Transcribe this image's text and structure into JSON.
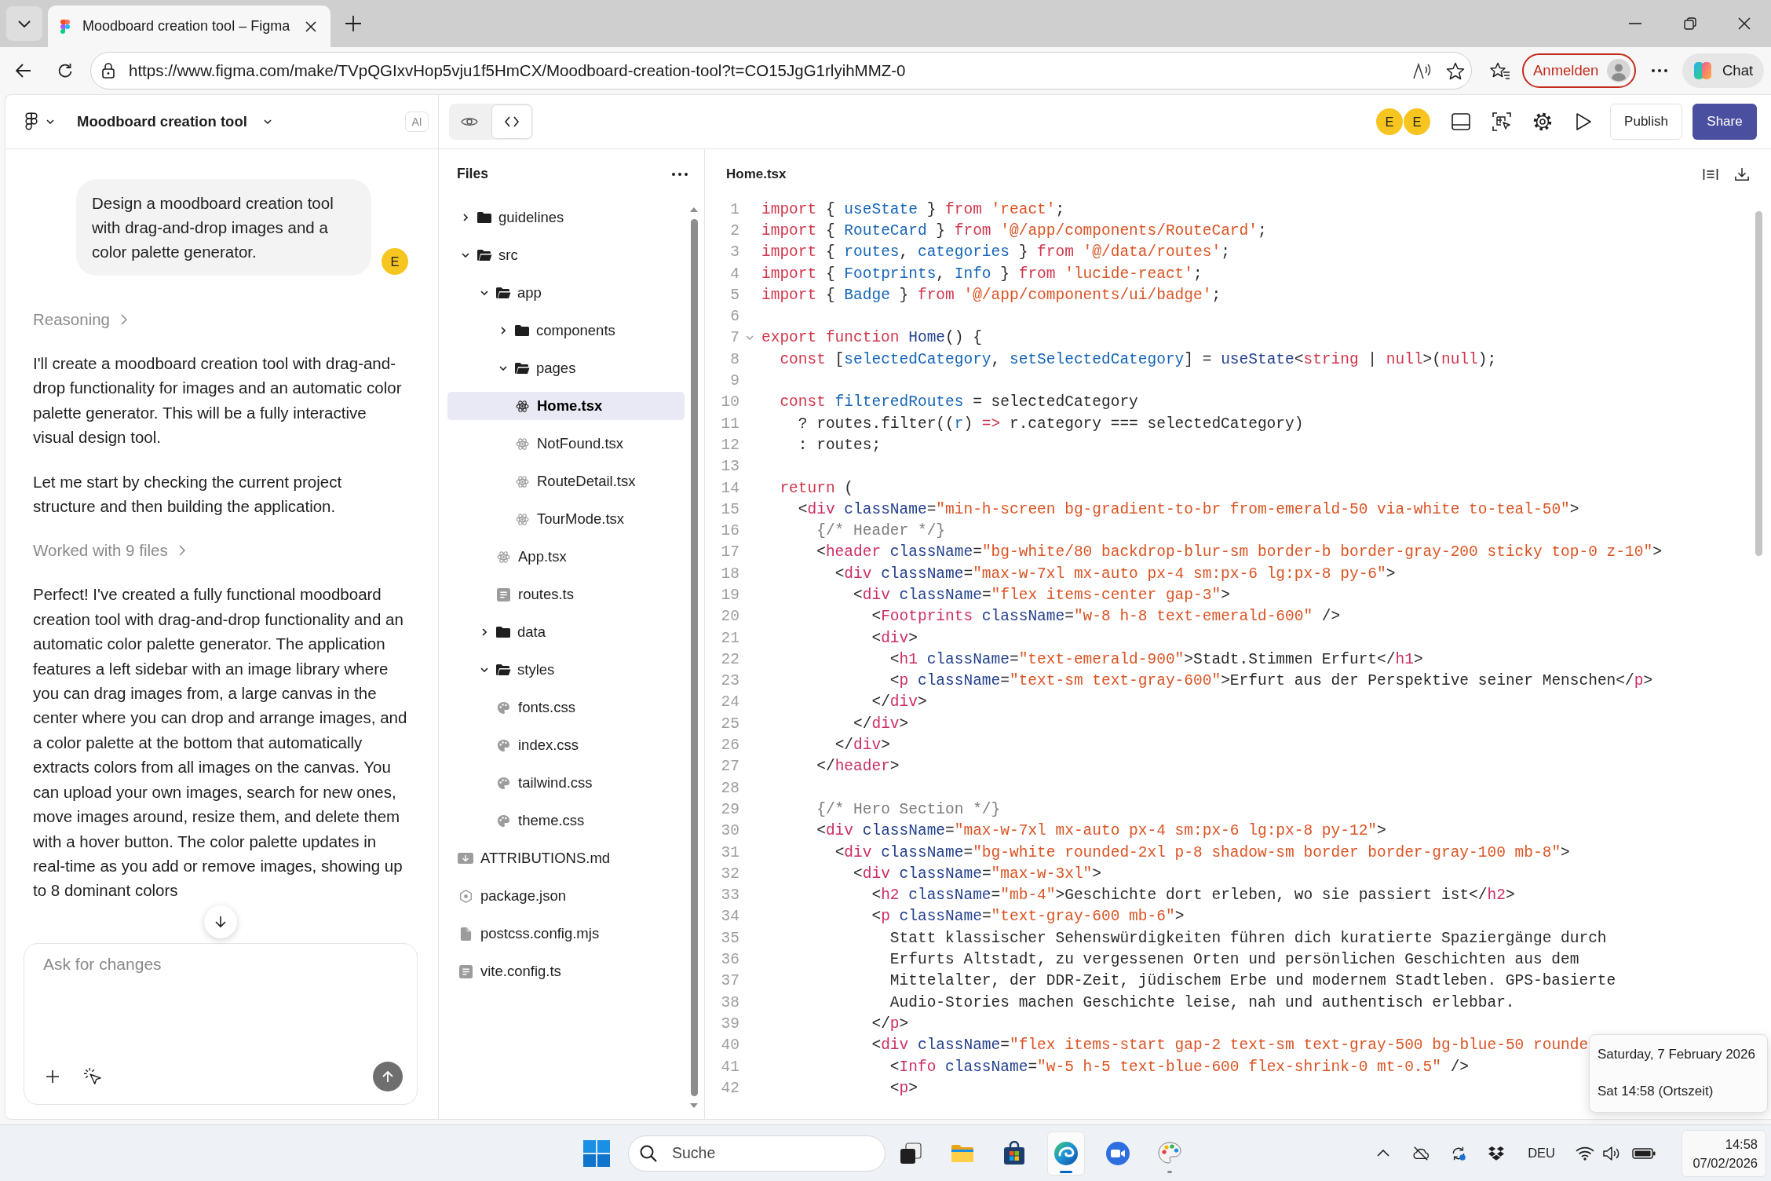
{
  "browser": {
    "tab": {
      "title": "Moodboard creation tool – Figma"
    },
    "address_bar": {
      "url": "https://www.figma.com/make/TVpQGIxvHop5vju1f5HmCX/Moodboard-creation-tool?t=CO15JgG1rlyihMMZ-0"
    },
    "sign_in_button": "Anmelden",
    "chat_button": "Chat"
  },
  "toolbar": {
    "project_title": "Moodboard creation tool",
    "ai_badge": "AI",
    "view_modes": [
      {
        "kind": "preview",
        "selected": false
      },
      {
        "kind": "code",
        "selected": true
      }
    ],
    "collaborators": [
      {
        "initial": "E"
      },
      {
        "initial": "E"
      }
    ],
    "publish_button": "Publish",
    "share_button": "Share"
  },
  "chat": {
    "messages": [
      {
        "kind": "user",
        "text": "Design a moodboard creation tool with drag-and-drop images and a color palette generator.",
        "avatar": "E"
      },
      {
        "kind": "toggle",
        "text": "Reasoning",
        "expanded": false
      },
      {
        "kind": "paragraph",
        "text": "I'll create a moodboard creation tool with drag-and-drop functionality for images and an automatic color palette generator. This will be a fully interactive visual design tool."
      },
      {
        "kind": "paragraph",
        "text": "Let me start by checking the current project structure and then building the application."
      },
      {
        "kind": "toggle",
        "text": "Worked with 9 files",
        "expanded": false
      },
      {
        "kind": "paragraph",
        "text": "Perfect! I've created a fully functional moodboard creation tool with drag-and-drop functionality and an automatic color palette generator. The application features a left sidebar with an image library where you can drag images from, a large canvas in the center where you can drop and arrange images, and a color palette at the bottom that automatically extracts colors from all images on the canvas. You can upload your own images, search for new ones, move images around, resize them, and delete them with a hover button. The color palette updates in real-time as you add or remove images, showing up to 8 dominant colors"
      }
    ],
    "input": {
      "placeholder": "Ask for changes"
    }
  },
  "files": {
    "title": "Files",
    "tree": [
      {
        "label": "guidelines",
        "kind": "folder",
        "expanded": false,
        "selected": false
      },
      {
        "label": "src",
        "kind": "folder",
        "expanded": true,
        "selected": false,
        "children": [
          {
            "label": "app",
            "kind": "folder",
            "expanded": true,
            "selected": false,
            "children": [
              {
                "label": "components",
                "kind": "folder",
                "expanded": false,
                "selected": false
              },
              {
                "label": "pages",
                "kind": "folder",
                "expanded": true,
                "selected": false,
                "children": [
                  {
                    "label": "Home.tsx",
                    "kind": "react",
                    "selected": true
                  },
                  {
                    "label": "NotFound.tsx",
                    "kind": "react",
                    "selected": false
                  },
                  {
                    "label": "RouteDetail.tsx",
                    "kind": "react",
                    "selected": false
                  },
                  {
                    "label": "TourMode.tsx",
                    "kind": "react",
                    "selected": false
                  }
                ]
              },
              {
                "label": "App.tsx",
                "kind": "react",
                "selected": false
              },
              {
                "label": "routes.ts",
                "kind": "ts",
                "selected": false
              }
            ]
          },
          {
            "label": "data",
            "kind": "folder",
            "expanded": false,
            "selected": false
          },
          {
            "label": "styles",
            "kind": "folder",
            "expanded": true,
            "selected": false,
            "children": [
              {
                "label": "fonts.css",
                "kind": "css",
                "selected": false
              },
              {
                "label": "index.css",
                "kind": "css",
                "selected": false
              },
              {
                "label": "tailwind.css",
                "kind": "css",
                "selected": false
              },
              {
                "label": "theme.css",
                "kind": "css",
                "selected": false
              }
            ]
          }
        ]
      },
      {
        "label": "ATTRIBUTIONS.md",
        "kind": "markdown",
        "selected": false
      },
      {
        "label": "package.json",
        "kind": "package",
        "selected": false
      },
      {
        "label": "postcss.config.mjs",
        "kind": "file",
        "selected": false
      },
      {
        "label": "vite.config.ts",
        "kind": "ts",
        "selected": false
      }
    ]
  },
  "editor": {
    "filename": "Home.tsx",
    "lines": [
      {
        "number": "1",
        "fold_marker": false,
        "tokens": [
          {
            "kind": "keyword",
            "text": "import"
          },
          {
            "kind": "plain",
            "text": " { "
          },
          {
            "kind": "variable",
            "text": "useState"
          },
          {
            "kind": "plain",
            "text": " } "
          },
          {
            "kind": "keyword",
            "text": "from"
          },
          {
            "kind": "string",
            "text": " 'react'"
          },
          {
            "kind": "plain",
            "text": ";"
          }
        ]
      },
      {
        "number": "2",
        "fold_marker": false,
        "tokens": [
          {
            "kind": "keyword",
            "text": "import"
          },
          {
            "kind": "plain",
            "text": " { "
          },
          {
            "kind": "variable",
            "text": "RouteCard"
          },
          {
            "kind": "plain",
            "text": " } "
          },
          {
            "kind": "keyword",
            "text": "from"
          },
          {
            "kind": "string",
            "text": " '@/app/components/RouteCard'"
          },
          {
            "kind": "plain",
            "text": ";"
          }
        ]
      },
      {
        "number": "3",
        "fold_marker": false,
        "tokens": [
          {
            "kind": "keyword",
            "text": "import"
          },
          {
            "kind": "plain",
            "text": " { "
          },
          {
            "kind": "variable",
            "text": "routes"
          },
          {
            "kind": "plain",
            "text": ", "
          },
          {
            "kind": "variable",
            "text": "categories"
          },
          {
            "kind": "plain",
            "text": " } "
          },
          {
            "kind": "keyword",
            "text": "from"
          },
          {
            "kind": "string",
            "text": " '@/data/routes'"
          },
          {
            "kind": "plain",
            "text": ";"
          }
        ]
      },
      {
        "number": "4",
        "fold_marker": false,
        "tokens": [
          {
            "kind": "keyword",
            "text": "import"
          },
          {
            "kind": "plain",
            "text": " { "
          },
          {
            "kind": "variable",
            "text": "Footprints"
          },
          {
            "kind": "plain",
            "text": ", "
          },
          {
            "kind": "variable",
            "text": "Info"
          },
          {
            "kind": "plain",
            "text": " } "
          },
          {
            "kind": "keyword",
            "text": "from"
          },
          {
            "kind": "string",
            "text": " 'lucide-react'"
          },
          {
            "kind": "plain",
            "text": ";"
          }
        ]
      },
      {
        "number": "5",
        "fold_marker": false,
        "tokens": [
          {
            "kind": "keyword",
            "text": "import"
          },
          {
            "kind": "plain",
            "text": " { "
          },
          {
            "kind": "variable",
            "text": "Badge"
          },
          {
            "kind": "plain",
            "text": " } "
          },
          {
            "kind": "keyword",
            "text": "from"
          },
          {
            "kind": "string",
            "text": " '@/app/components/ui/badge'"
          },
          {
            "kind": "plain",
            "text": ";"
          }
        ]
      },
      {
        "number": "6",
        "fold_marker": false
      },
      {
        "number": "7",
        "fold_marker": true,
        "tokens": [
          {
            "kind": "keyword",
            "text": "export function"
          },
          {
            "kind": "function",
            "text": " Home"
          },
          {
            "kind": "plain",
            "text": "() {"
          }
        ]
      },
      {
        "number": "8",
        "fold_marker": false,
        "tokens": [
          {
            "kind": "keyword",
            "text": "  const"
          },
          {
            "kind": "plain",
            "text": " ["
          },
          {
            "kind": "variable",
            "text": "selectedCategory"
          },
          {
            "kind": "plain",
            "text": ", "
          },
          {
            "kind": "variable",
            "text": "setSelectedCategory"
          },
          {
            "kind": "plain",
            "text": "] = "
          },
          {
            "kind": "function",
            "text": "useState"
          },
          {
            "kind": "plain",
            "text": "<"
          },
          {
            "kind": "keyword",
            "text": "string"
          },
          {
            "kind": "plain",
            "text": " | "
          },
          {
            "kind": "keyword",
            "text": "null"
          },
          {
            "kind": "plain",
            "text": ">("
          },
          {
            "kind": "keyword",
            "text": "null"
          },
          {
            "kind": "plain",
            "text": ");"
          }
        ]
      },
      {
        "number": "9",
        "fold_marker": false
      },
      {
        "number": "10",
        "fold_marker": false,
        "tokens": [
          {
            "kind": "keyword",
            "text": "  const"
          },
          {
            "kind": "variable",
            "text": " filteredRoutes"
          },
          {
            "kind": "plain",
            "text": " = selectedCategory"
          }
        ]
      },
      {
        "number": "11",
        "fold_marker": false,
        "tokens": [
          {
            "kind": "plain",
            "text": "    ? routes.filter(("
          },
          {
            "kind": "variable",
            "text": "r"
          },
          {
            "kind": "plain",
            "text": ") "
          },
          {
            "kind": "keyword",
            "text": "=>"
          },
          {
            "kind": "plain",
            "text": " r.category === selectedCategory)"
          }
        ]
      },
      {
        "number": "12",
        "fold_marker": false,
        "tokens": [
          {
            "kind": "plain",
            "text": "    : routes;"
          }
        ]
      },
      {
        "number": "13",
        "fold_marker": false
      },
      {
        "number": "14",
        "fold_marker": false,
        "tokens": [
          {
            "kind": "keyword",
            "text": "  return"
          },
          {
            "kind": "plain",
            "text": " ("
          }
        ]
      },
      {
        "number": "15",
        "fold_marker": false,
        "tokens": [
          {
            "kind": "plain",
            "text": "    <"
          },
          {
            "kind": "tag",
            "text": "div"
          },
          {
            "kind": "attribute",
            "text": " className"
          },
          {
            "kind": "plain",
            "text": "="
          },
          {
            "kind": "string",
            "text": "\"min-h-screen bg-gradient-to-br from-emerald-50 via-white to-teal-50\""
          },
          {
            "kind": "plain",
            "text": ">"
          }
        ]
      },
      {
        "number": "16",
        "fold_marker": false,
        "tokens": [
          {
            "kind": "comment",
            "text": "      {/* Header */}"
          }
        ]
      },
      {
        "number": "17",
        "fold_marker": false,
        "tokens": [
          {
            "kind": "plain",
            "text": "      <"
          },
          {
            "kind": "tag",
            "text": "header"
          },
          {
            "kind": "attribute",
            "text": " className"
          },
          {
            "kind": "plain",
            "text": "="
          },
          {
            "kind": "string",
            "text": "\"bg-white/80 backdrop-blur-sm border-b border-gray-200 sticky top-0 z-10\""
          },
          {
            "kind": "plain",
            "text": ">"
          }
        ]
      },
      {
        "number": "18",
        "fold_marker": false,
        "tokens": [
          {
            "kind": "plain",
            "text": "        <"
          },
          {
            "kind": "tag",
            "text": "div"
          },
          {
            "kind": "attribute",
            "text": " className"
          },
          {
            "kind": "plain",
            "text": "="
          },
          {
            "kind": "string",
            "text": "\"max-w-7xl mx-auto px-4 sm:px-6 lg:px-8 py-6\""
          },
          {
            "kind": "plain",
            "text": ">"
          }
        ]
      },
      {
        "number": "19",
        "fold_marker": false,
        "tokens": [
          {
            "kind": "plain",
            "text": "          <"
          },
          {
            "kind": "tag",
            "text": "div"
          },
          {
            "kind": "attribute",
            "text": " className"
          },
          {
            "kind": "plain",
            "text": "="
          },
          {
            "kind": "string",
            "text": "\"flex items-center gap-3\""
          },
          {
            "kind": "plain",
            "text": ">"
          }
        ]
      },
      {
        "number": "20",
        "fold_marker": false,
        "tokens": [
          {
            "kind": "plain",
            "text": "            <"
          },
          {
            "kind": "tag",
            "text": "Footprints"
          },
          {
            "kind": "attribute",
            "text": " className"
          },
          {
            "kind": "plain",
            "text": "="
          },
          {
            "kind": "string",
            "text": "\"w-8 h-8 text-emerald-600\""
          },
          {
            "kind": "plain",
            "text": " />"
          }
        ]
      },
      {
        "number": "21",
        "fold_marker": false,
        "tokens": [
          {
            "kind": "plain",
            "text": "            <"
          },
          {
            "kind": "tag",
            "text": "div"
          },
          {
            "kind": "plain",
            "text": ">"
          }
        ]
      },
      {
        "number": "22",
        "fold_marker": false,
        "tokens": [
          {
            "kind": "plain",
            "text": "              <"
          },
          {
            "kind": "tag",
            "text": "h1"
          },
          {
            "kind": "attribute",
            "text": " className"
          },
          {
            "kind": "plain",
            "text": "="
          },
          {
            "kind": "string",
            "text": "\"text-emerald-900\""
          },
          {
            "kind": "plain",
            "text": ">Stadt.Stimmen Erfurt</"
          },
          {
            "kind": "tag",
            "text": "h1"
          },
          {
            "kind": "plain",
            "text": ">"
          }
        ]
      },
      {
        "number": "23",
        "fold_marker": false,
        "tokens": [
          {
            "kind": "plain",
            "text": "              <"
          },
          {
            "kind": "tag",
            "text": "p"
          },
          {
            "kind": "attribute",
            "text": " className"
          },
          {
            "kind": "plain",
            "text": "="
          },
          {
            "kind": "string",
            "text": "\"text-sm text-gray-600\""
          },
          {
            "kind": "plain",
            "text": ">Erfurt aus der Perspektive seiner Menschen</"
          },
          {
            "kind": "tag",
            "text": "p"
          },
          {
            "kind": "plain",
            "text": ">"
          }
        ]
      },
      {
        "number": "24",
        "fold_marker": false,
        "tokens": [
          {
            "kind": "plain",
            "text": "            </"
          },
          {
            "kind": "tag",
            "text": "div"
          },
          {
            "kind": "plain",
            "text": ">"
          }
        ]
      },
      {
        "number": "25",
        "fold_marker": false,
        "tokens": [
          {
            "kind": "plain",
            "text": "          </"
          },
          {
            "kind": "tag",
            "text": "div"
          },
          {
            "kind": "plain",
            "text": ">"
          }
        ]
      },
      {
        "number": "26",
        "fold_marker": false,
        "tokens": [
          {
            "kind": "plain",
            "text": "        </"
          },
          {
            "kind": "tag",
            "text": "div"
          },
          {
            "kind": "plain",
            "text": ">"
          }
        ]
      },
      {
        "number": "27",
        "fold_marker": false,
        "tokens": [
          {
            "kind": "plain",
            "text": "      </"
          },
          {
            "kind": "tag",
            "text": "header"
          },
          {
            "kind": "plain",
            "text": ">"
          }
        ]
      },
      {
        "number": "28",
        "fold_marker": false
      },
      {
        "number": "29",
        "fold_marker": false,
        "tokens": [
          {
            "kind": "comment",
            "text": "      {/* Hero Section */}"
          }
        ]
      },
      {
        "number": "30",
        "fold_marker": false,
        "tokens": [
          {
            "kind": "plain",
            "text": "      <"
          },
          {
            "kind": "tag",
            "text": "div"
          },
          {
            "kind": "attribute",
            "text": " className"
          },
          {
            "kind": "plain",
            "text": "="
          },
          {
            "kind": "string",
            "text": "\"max-w-7xl mx-auto px-4 sm:px-6 lg:px-8 py-12\""
          },
          {
            "kind": "plain",
            "text": ">"
          }
        ]
      },
      {
        "number": "31",
        "fold_marker": false,
        "tokens": [
          {
            "kind": "plain",
            "text": "        <"
          },
          {
            "kind": "tag",
            "text": "div"
          },
          {
            "kind": "attribute",
            "text": " className"
          },
          {
            "kind": "plain",
            "text": "="
          },
          {
            "kind": "string",
            "text": "\"bg-white rounded-2xl p-8 shadow-sm border border-gray-100 mb-8\""
          },
          {
            "kind": "plain",
            "text": ">"
          }
        ]
      },
      {
        "number": "32",
        "fold_marker": false,
        "tokens": [
          {
            "kind": "plain",
            "text": "          <"
          },
          {
            "kind": "tag",
            "text": "div"
          },
          {
            "kind": "attribute",
            "text": " className"
          },
          {
            "kind": "plain",
            "text": "="
          },
          {
            "kind": "string",
            "text": "\"max-w-3xl\""
          },
          {
            "kind": "plain",
            "text": ">"
          }
        ]
      },
      {
        "number": "33",
        "fold_marker": false,
        "tokens": [
          {
            "kind": "plain",
            "text": "            <"
          },
          {
            "kind": "tag",
            "text": "h2"
          },
          {
            "kind": "attribute",
            "text": " className"
          },
          {
            "kind": "plain",
            "text": "="
          },
          {
            "kind": "string",
            "text": "\"mb-4\""
          },
          {
            "kind": "plain",
            "text": ">Geschichte dort erleben, wo sie passiert ist</"
          },
          {
            "kind": "tag",
            "text": "h2"
          },
          {
            "kind": "plain",
            "text": ">"
          }
        ]
      },
      {
        "number": "34",
        "fold_marker": false,
        "tokens": [
          {
            "kind": "plain",
            "text": "            <"
          },
          {
            "kind": "tag",
            "text": "p"
          },
          {
            "kind": "attribute",
            "text": " className"
          },
          {
            "kind": "plain",
            "text": "="
          },
          {
            "kind": "string",
            "text": "\"text-gray-600 mb-6\""
          },
          {
            "kind": "plain",
            "text": ">"
          }
        ]
      },
      {
        "number": "35",
        "fold_marker": false,
        "tokens": [
          {
            "kind": "plain",
            "text": "              Statt klassischer Sehenswürdigkeiten führen dich kuratierte Spaziergänge durch"
          }
        ]
      },
      {
        "number": "36",
        "fold_marker": false,
        "tokens": [
          {
            "kind": "plain",
            "text": "              Erfurts Altstadt, zu vergessenen Orten und persönlichen Geschichten aus dem"
          }
        ]
      },
      {
        "number": "37",
        "fold_marker": false,
        "tokens": [
          {
            "kind": "plain",
            "text": "              Mittelalter, der DDR-Zeit, jüdischem Erbe und modernem Stadtleben. GPS-basierte"
          }
        ]
      },
      {
        "number": "38",
        "fold_marker": false,
        "tokens": [
          {
            "kind": "plain",
            "text": "              Audio-Stories machen Geschichte leise, nah und authentisch erlebbar."
          }
        ]
      },
      {
        "number": "39",
        "fold_marker": false,
        "tokens": [
          {
            "kind": "plain",
            "text": "            </"
          },
          {
            "kind": "tag",
            "text": "p"
          },
          {
            "kind": "plain",
            "text": ">"
          }
        ]
      },
      {
        "number": "40",
        "fold_marker": false,
        "tokens": [
          {
            "kind": "plain",
            "text": "            <"
          },
          {
            "kind": "tag",
            "text": "div"
          },
          {
            "kind": "attribute",
            "text": " className"
          },
          {
            "kind": "plain",
            "text": "="
          },
          {
            "kind": "string",
            "text": "\"flex items-start gap-2 text-sm text-gray-500 bg-blue-50 rounde"
          }
        ]
      },
      {
        "number": "41",
        "fold_marker": false,
        "tokens": [
          {
            "kind": "plain",
            "text": "              <"
          },
          {
            "kind": "tag",
            "text": "Info"
          },
          {
            "kind": "attribute",
            "text": " className"
          },
          {
            "kind": "plain",
            "text": "="
          },
          {
            "kind": "string",
            "text": "\"w-5 h-5 text-blue-600 flex-shrink-0 mt-0.5\""
          },
          {
            "kind": "plain",
            "text": " />"
          }
        ]
      },
      {
        "number": "42",
        "fold_marker": false,
        "tokens": [
          {
            "kind": "plain",
            "text": "              <"
          },
          {
            "kind": "tag",
            "text": "p"
          },
          {
            "kind": "plain",
            "text": ">"
          }
        ]
      }
    ]
  },
  "clock_flyout": {
    "date": "Saturday, 7 February 2026",
    "time": "Sat 14:58 (Ortszeit)"
  },
  "taskbar": {
    "search": {
      "placeholder": "Suche"
    },
    "apps": [
      {
        "kind": "task_view",
        "running": false,
        "active": false
      },
      {
        "kind": "explorer",
        "running": false,
        "active": false
      },
      {
        "kind": "store",
        "running": false,
        "active": false
      },
      {
        "kind": "edge",
        "running": true,
        "active": true
      },
      {
        "kind": "zoom",
        "running": false,
        "active": false
      },
      {
        "kind": "paint",
        "running": true,
        "active": false
      }
    ],
    "language": "DEU",
    "time": "14:58",
    "date": "07/02/2026"
  }
}
